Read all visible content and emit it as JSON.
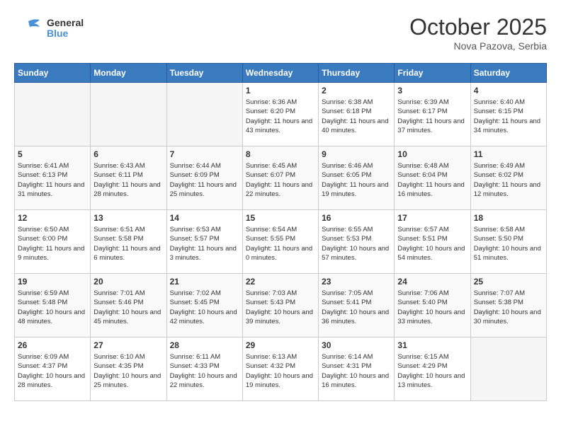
{
  "header": {
    "logo_text_general": "General",
    "logo_text_blue": "Blue",
    "month": "October 2025",
    "location": "Nova Pazova, Serbia"
  },
  "days_of_week": [
    "Sunday",
    "Monday",
    "Tuesday",
    "Wednesday",
    "Thursday",
    "Friday",
    "Saturday"
  ],
  "weeks": [
    [
      {
        "day": "",
        "empty": true
      },
      {
        "day": "",
        "empty": true
      },
      {
        "day": "",
        "empty": true
      },
      {
        "day": "1",
        "sunrise": "6:36 AM",
        "sunset": "6:20 PM",
        "daylight": "11 hours and 43 minutes."
      },
      {
        "day": "2",
        "sunrise": "6:38 AM",
        "sunset": "6:18 PM",
        "daylight": "11 hours and 40 minutes."
      },
      {
        "day": "3",
        "sunrise": "6:39 AM",
        "sunset": "6:17 PM",
        "daylight": "11 hours and 37 minutes."
      },
      {
        "day": "4",
        "sunrise": "6:40 AM",
        "sunset": "6:15 PM",
        "daylight": "11 hours and 34 minutes."
      }
    ],
    [
      {
        "day": "5",
        "sunrise": "6:41 AM",
        "sunset": "6:13 PM",
        "daylight": "11 hours and 31 minutes."
      },
      {
        "day": "6",
        "sunrise": "6:43 AM",
        "sunset": "6:11 PM",
        "daylight": "11 hours and 28 minutes."
      },
      {
        "day": "7",
        "sunrise": "6:44 AM",
        "sunset": "6:09 PM",
        "daylight": "11 hours and 25 minutes."
      },
      {
        "day": "8",
        "sunrise": "6:45 AM",
        "sunset": "6:07 PM",
        "daylight": "11 hours and 22 minutes."
      },
      {
        "day": "9",
        "sunrise": "6:46 AM",
        "sunset": "6:05 PM",
        "daylight": "11 hours and 19 minutes."
      },
      {
        "day": "10",
        "sunrise": "6:48 AM",
        "sunset": "6:04 PM",
        "daylight": "11 hours and 16 minutes."
      },
      {
        "day": "11",
        "sunrise": "6:49 AM",
        "sunset": "6:02 PM",
        "daylight": "11 hours and 12 minutes."
      }
    ],
    [
      {
        "day": "12",
        "sunrise": "6:50 AM",
        "sunset": "6:00 PM",
        "daylight": "11 hours and 9 minutes."
      },
      {
        "day": "13",
        "sunrise": "6:51 AM",
        "sunset": "5:58 PM",
        "daylight": "11 hours and 6 minutes."
      },
      {
        "day": "14",
        "sunrise": "6:53 AM",
        "sunset": "5:57 PM",
        "daylight": "11 hours and 3 minutes."
      },
      {
        "day": "15",
        "sunrise": "6:54 AM",
        "sunset": "5:55 PM",
        "daylight": "11 hours and 0 minutes."
      },
      {
        "day": "16",
        "sunrise": "6:55 AM",
        "sunset": "5:53 PM",
        "daylight": "10 hours and 57 minutes."
      },
      {
        "day": "17",
        "sunrise": "6:57 AM",
        "sunset": "5:51 PM",
        "daylight": "10 hours and 54 minutes."
      },
      {
        "day": "18",
        "sunrise": "6:58 AM",
        "sunset": "5:50 PM",
        "daylight": "10 hours and 51 minutes."
      }
    ],
    [
      {
        "day": "19",
        "sunrise": "6:59 AM",
        "sunset": "5:48 PM",
        "daylight": "10 hours and 48 minutes."
      },
      {
        "day": "20",
        "sunrise": "7:01 AM",
        "sunset": "5:46 PM",
        "daylight": "10 hours and 45 minutes."
      },
      {
        "day": "21",
        "sunrise": "7:02 AM",
        "sunset": "5:45 PM",
        "daylight": "10 hours and 42 minutes."
      },
      {
        "day": "22",
        "sunrise": "7:03 AM",
        "sunset": "5:43 PM",
        "daylight": "10 hours and 39 minutes."
      },
      {
        "day": "23",
        "sunrise": "7:05 AM",
        "sunset": "5:41 PM",
        "daylight": "10 hours and 36 minutes."
      },
      {
        "day": "24",
        "sunrise": "7:06 AM",
        "sunset": "5:40 PM",
        "daylight": "10 hours and 33 minutes."
      },
      {
        "day": "25",
        "sunrise": "7:07 AM",
        "sunset": "5:38 PM",
        "daylight": "10 hours and 30 minutes."
      }
    ],
    [
      {
        "day": "26",
        "sunrise": "6:09 AM",
        "sunset": "4:37 PM",
        "daylight": "10 hours and 28 minutes."
      },
      {
        "day": "27",
        "sunrise": "6:10 AM",
        "sunset": "4:35 PM",
        "daylight": "10 hours and 25 minutes."
      },
      {
        "day": "28",
        "sunrise": "6:11 AM",
        "sunset": "4:33 PM",
        "daylight": "10 hours and 22 minutes."
      },
      {
        "day": "29",
        "sunrise": "6:13 AM",
        "sunset": "4:32 PM",
        "daylight": "10 hours and 19 minutes."
      },
      {
        "day": "30",
        "sunrise": "6:14 AM",
        "sunset": "4:31 PM",
        "daylight": "10 hours and 16 minutes."
      },
      {
        "day": "31",
        "sunrise": "6:15 AM",
        "sunset": "4:29 PM",
        "daylight": "10 hours and 13 minutes."
      },
      {
        "day": "",
        "empty": true
      }
    ]
  ]
}
